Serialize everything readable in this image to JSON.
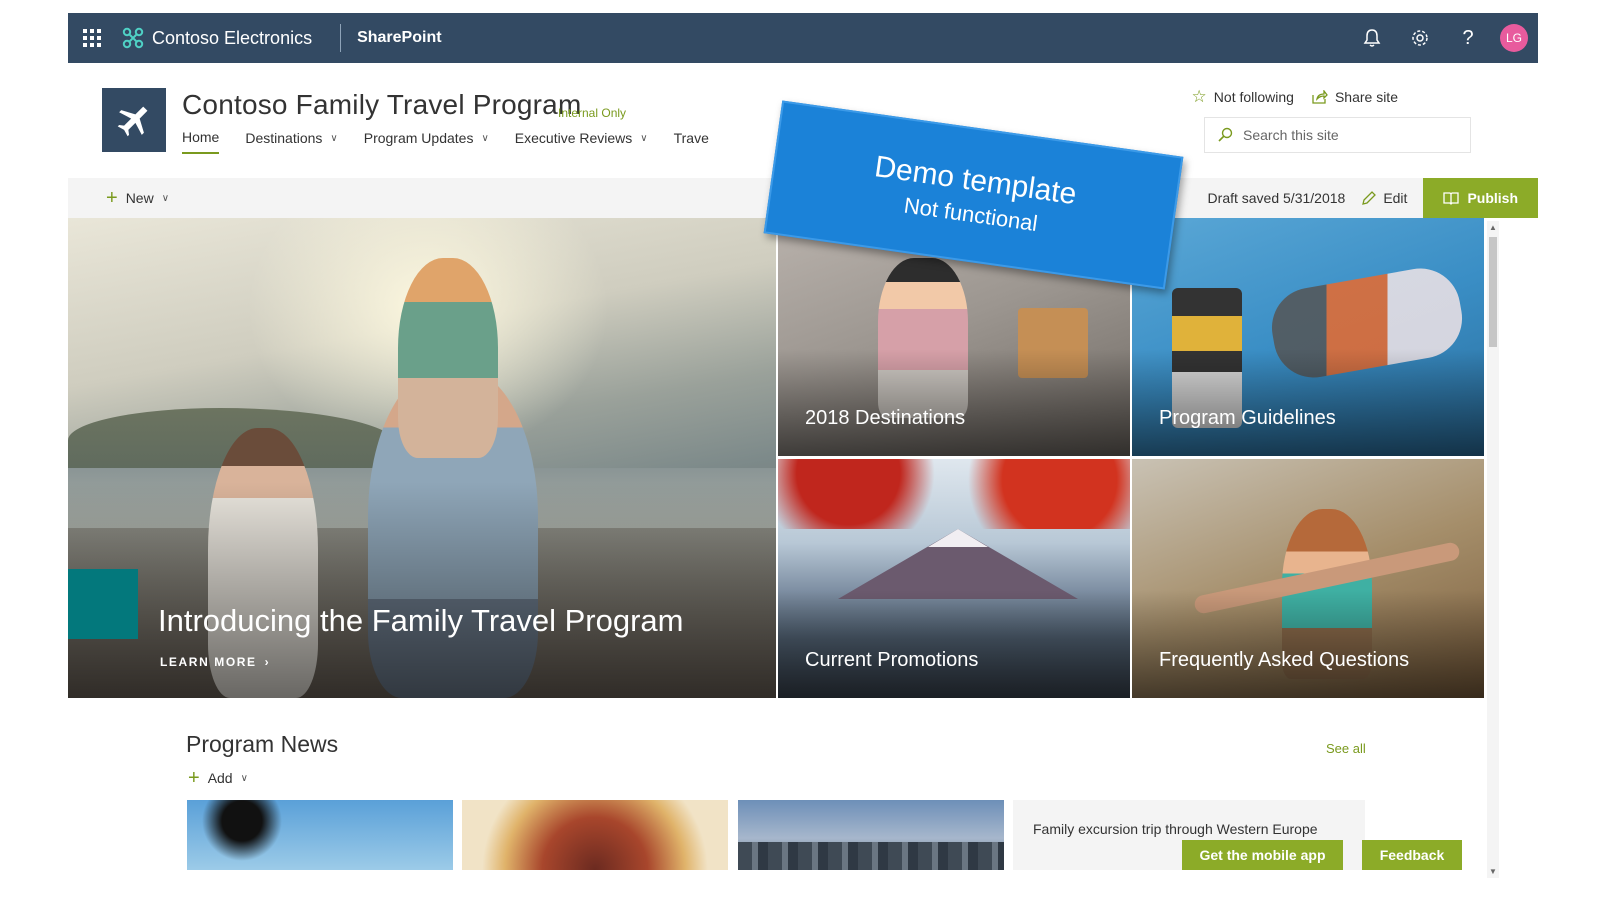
{
  "suite_bar": {
    "org_name": "Contoso Electronics",
    "app_name": "SharePoint",
    "avatar_initials": "LG",
    "bar_color": "#334a63"
  },
  "site": {
    "title": "Contoso Family Travel Program",
    "classification": "Internal Only",
    "nav": [
      {
        "label": "Home",
        "active": true
      },
      {
        "label": "Destinations"
      },
      {
        "label": "Program Updates"
      },
      {
        "label": "Executive Reviews"
      },
      {
        "label": "Trave"
      }
    ],
    "follow_label": "Not following",
    "share_label": "Share site",
    "search_placeholder": "Search this site"
  },
  "command_bar": {
    "new_label": "New",
    "draft_status": "Draft saved 5/31/2018",
    "edit_label": "Edit",
    "publish_label": "Publish",
    "accent_color": "#8cab28"
  },
  "hero": {
    "main": {
      "title": "Introducing the Family Travel Program",
      "link_label": "LEARN MORE"
    },
    "tiles": [
      {
        "label": "2018 Destinations"
      },
      {
        "label": "Program Guidelines"
      },
      {
        "label": "Current Promotions"
      },
      {
        "label": "Frequently Asked Questions"
      }
    ]
  },
  "news": {
    "title": "Program News",
    "see_all": "See all",
    "add_label": "Add",
    "cards": [
      {
        "title": "Family excursion trip through Western Europe"
      }
    ]
  },
  "floating": {
    "mobile_app": "Get the mobile app",
    "feedback": "Feedback"
  },
  "demo_banner": {
    "line1": "Demo template",
    "line2": "Not functional",
    "color": "#1b82d8"
  }
}
